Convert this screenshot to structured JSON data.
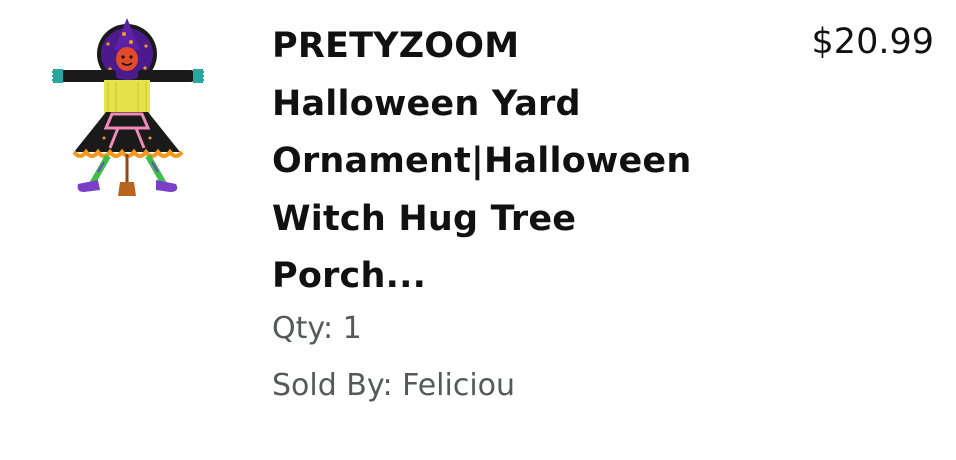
{
  "item": {
    "image_alt": "PRETYZOOM Halloween witch yard ornament product image",
    "title_lines": [
      "PRETYZOOM",
      "Halloween Yard",
      "Ornament|Halloween",
      "Witch Hug Tree",
      "Porch..."
    ],
    "price": "$20.99",
    "quantity": "Qty: 1",
    "sold_by": "Sold By: Feliciou"
  },
  "colors": {
    "text_primary": "#111111",
    "text_secondary": "#565959",
    "witch_hat": "#4b1a8c",
    "witch_dress": "#1a1a1a",
    "witch_hair": "#e6e24a",
    "witch_trim": "#f39a1e",
    "witch_sash": "#f08ab8",
    "witch_shoes": "#7b3fc7",
    "witch_socks": "#3cbf4a",
    "witch_hands": "#2aa6a0"
  }
}
